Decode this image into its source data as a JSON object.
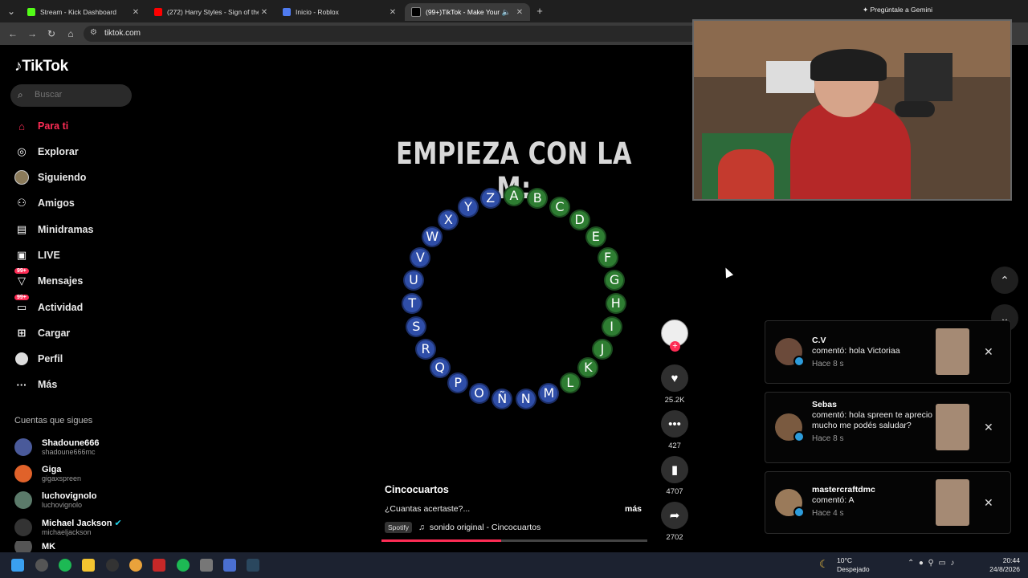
{
  "browser": {
    "tabs": [
      {
        "label": "Stream - Kick Dashboard",
        "icon": "kick-icon",
        "active": false
      },
      {
        "label": "(272) Harry Styles - Sign of the",
        "icon": "youtube-icon",
        "active": false
      },
      {
        "label": "Inicio - Roblox",
        "icon": "roblox-icon",
        "active": false
      },
      {
        "label": "(99+)TikTok - Make Your Da",
        "icon": "tiktok-icon",
        "active": true
      }
    ],
    "new_tab": "+",
    "gemini": "Pregúntale a Gemini",
    "url": "tiktok.com"
  },
  "sidebar": {
    "logo": "TikTok",
    "search_placeholder": "Buscar",
    "nav": [
      {
        "label": "Para ti",
        "icon": "home-icon"
      },
      {
        "label": "Explorar",
        "icon": "compass-icon"
      },
      {
        "label": "Siguiendo",
        "icon": "following-avatar-icon"
      },
      {
        "label": "Amigos",
        "icon": "friends-icon"
      },
      {
        "label": "Minidramas",
        "icon": "film-icon"
      },
      {
        "label": "LIVE",
        "icon": "live-icon"
      },
      {
        "label": "Mensajes",
        "icon": "message-icon",
        "badge": "99+"
      },
      {
        "label": "Actividad",
        "icon": "activity-icon",
        "badge": "99+"
      },
      {
        "label": "Cargar",
        "icon": "upload-icon"
      },
      {
        "label": "Perfil",
        "icon": "profile-icon"
      },
      {
        "label": "Más",
        "icon": "more-icon"
      }
    ],
    "following_title": "Cuentas que sigues",
    "following": [
      {
        "name": "Shadoune666",
        "handle": "shadoune666mc"
      },
      {
        "name": "Giga",
        "handle": "gigaxspreen"
      },
      {
        "name": "luchovignolo",
        "handle": "luchovignolo"
      },
      {
        "name": "Michael Jackson",
        "handle": "michaeljackson"
      },
      {
        "name": "MK",
        "handle": ""
      }
    ]
  },
  "video": {
    "title": "EMPIEZA CON LA M:",
    "wheel": [
      {
        "l": "A",
        "c": "g"
      },
      {
        "l": "B",
        "c": "g"
      },
      {
        "l": "C",
        "c": "g"
      },
      {
        "l": "D",
        "c": "g"
      },
      {
        "l": "E",
        "c": "g"
      },
      {
        "l": "F",
        "c": "g"
      },
      {
        "l": "G",
        "c": "g"
      },
      {
        "l": "H",
        "c": "g"
      },
      {
        "l": "I",
        "c": "g"
      },
      {
        "l": "J",
        "c": "g"
      },
      {
        "l": "K",
        "c": "g"
      },
      {
        "l": "L",
        "c": "g"
      },
      {
        "l": "M",
        "c": "b"
      },
      {
        "l": "N",
        "c": "b"
      },
      {
        "l": "Ñ",
        "c": "b"
      },
      {
        "l": "O",
        "c": "b"
      },
      {
        "l": "P",
        "c": "b"
      },
      {
        "l": "Q",
        "c": "b"
      },
      {
        "l": "R",
        "c": "b"
      },
      {
        "l": "S",
        "c": "b"
      },
      {
        "l": "T",
        "c": "b"
      },
      {
        "l": "U",
        "c": "b"
      },
      {
        "l": "V",
        "c": "b"
      },
      {
        "l": "W",
        "c": "b"
      },
      {
        "l": "X",
        "c": "b"
      },
      {
        "l": "Y",
        "c": "b"
      },
      {
        "l": "Z",
        "c": "b"
      }
    ],
    "author": "Cincocuartos",
    "caption": "¿Cuantas acertaste?...",
    "more": "más",
    "spotify_tag": "Spotify",
    "sound": "sonido original - Cincocuartos",
    "progress": 0.45,
    "actions": {
      "likes": "25.2K",
      "comments": "427",
      "saves": "4707",
      "shares": "2702"
    }
  },
  "notifications": [
    {
      "user": "C.V",
      "text": "comentó: hola Victoriaa",
      "time": "Hace 8 s"
    },
    {
      "user": "Sebas",
      "text": "comentó: hola spreen te aprecio mucho me podés saludar?",
      "time": "Hace 8 s"
    },
    {
      "user": "mastercraftdmc",
      "text": "comentó: A",
      "time": "Hace 4 s"
    }
  ],
  "taskbar": {
    "weather_temp": "10°C",
    "weather_desc": "Despejado",
    "time": "20:44",
    "date": "24/8/2026"
  },
  "colors": {
    "accent": "#fe2c55",
    "green_letter": "#2e7d32",
    "blue_letter": "#2f4ea8"
  }
}
